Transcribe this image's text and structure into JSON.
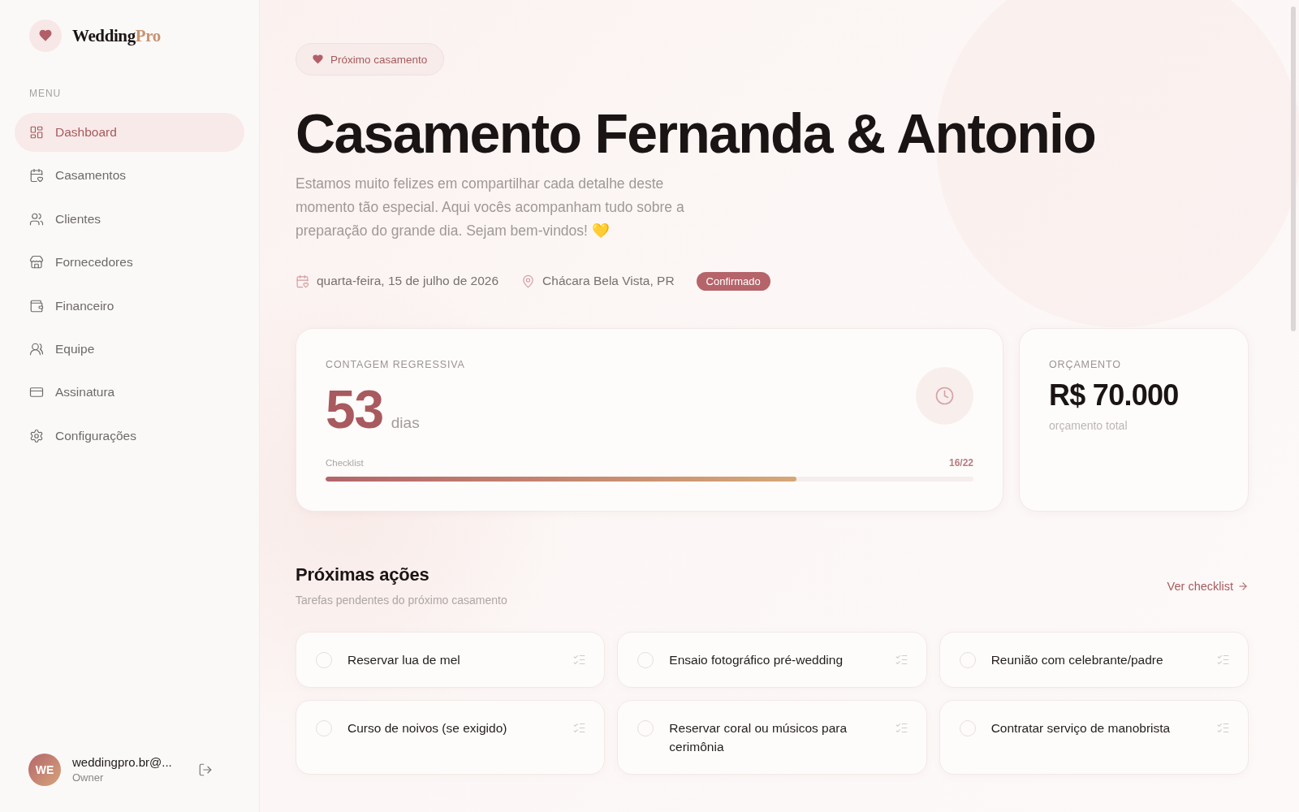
{
  "sidebar": {
    "brand": {
      "name": "Wedding",
      "accent": "Pro"
    },
    "menu_label": "MENU",
    "items": [
      {
        "label": "Dashboard",
        "selected": true
      },
      {
        "label": "Casamentos",
        "selected": false
      },
      {
        "label": "Clientes",
        "selected": false
      },
      {
        "label": "Fornecedores",
        "selected": false
      },
      {
        "label": "Financeiro",
        "selected": false
      },
      {
        "label": "Equipe",
        "selected": false
      },
      {
        "label": "Assinatura",
        "selected": false
      },
      {
        "label": "Configurações",
        "selected": false
      }
    ],
    "user": {
      "initials": "WE",
      "name": "weddingpro.br@...",
      "role": "Owner"
    }
  },
  "hero": {
    "badge": "Próximo casamento",
    "title": "Casamento Fernanda & Antonio",
    "description": "Estamos muito felizes em compartilhar cada detalhe deste momento tão especial. Aqui vocês acompanham tudo sobre a preparação do grande dia. Sejam bem-vindos! 💛",
    "date": "quarta-feira, 15 de julho de 2026",
    "location": "Chácara Bela Vista, PR",
    "status": "Confirmado"
  },
  "countdown": {
    "label": "CONTAGEM REGRESSIVA",
    "value": "53",
    "unit": "dias",
    "progress_label": "Checklist",
    "progress_count": "16/22",
    "level": 0.727
  },
  "budget": {
    "label": "ORÇAMENTO",
    "value": "R$ 70.000",
    "caption": "orçamento total"
  },
  "actions": {
    "title": "Próximas ações",
    "subtitle": "Tarefas pendentes do próximo casamento",
    "link": "Ver checklist",
    "tasks": [
      {
        "label": "Reservar lua de mel",
        "checked": false
      },
      {
        "label": "Ensaio fotográfico pré-wedding",
        "checked": false
      },
      {
        "label": "Reunião com celebrante/padre",
        "checked": false
      },
      {
        "label": "Curso de noivos (se exigido)",
        "checked": false
      },
      {
        "label": "Reservar coral ou músicos para cerimônia",
        "checked": false
      },
      {
        "label": "Contratar serviço de manobrista",
        "checked": false
      }
    ]
  }
}
